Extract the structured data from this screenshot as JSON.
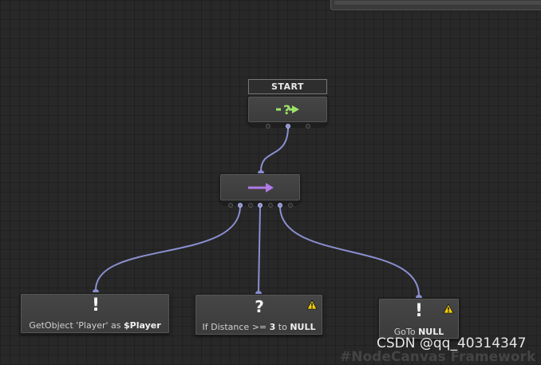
{
  "start_node": {
    "label": "START"
  },
  "nodes": {
    "getobject": {
      "glyph": "!",
      "caption_pre": "GetObject 'Player' as ",
      "caption_bold": "$Player"
    },
    "ifdistance": {
      "glyph": "?",
      "caption_pre": "If Distance >= ",
      "caption_bold1": "3",
      "caption_mid": " to ",
      "caption_bold2": "NULL"
    },
    "goto": {
      "glyph": "!",
      "caption_pre": "GoTo ",
      "caption_bold": "NULL"
    }
  },
  "colors": {
    "start_icon": "#9be36a",
    "sequencer_arrow": "#b07ae8",
    "wire": "#8a8fd0",
    "warning": "#f5d000"
  },
  "icons": {
    "start": "start-arrow-icon",
    "sequencer": "right-arrow-icon",
    "warning": "warning-icon"
  },
  "watermark": {
    "text": "CSDN @qq_40314347"
  },
  "background_text": {
    "text": "#NodeCanvas Framework"
  }
}
